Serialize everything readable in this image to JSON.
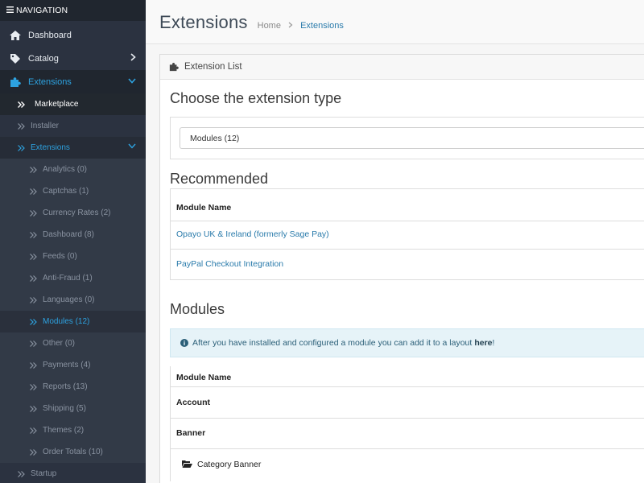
{
  "sidebar": {
    "header": "NAVIGATION",
    "dashboard": "Dashboard",
    "catalog": "Catalog",
    "extensions": "Extensions",
    "marketplace": "Marketplace",
    "installer": "Installer",
    "extensions_sub": "Extensions",
    "sub_items": [
      "Analytics (0)",
      "Captchas (1)",
      "Currency Rates (2)",
      "Dashboard (8)",
      "Feeds (0)",
      "Anti-Fraud (1)",
      "Languages (0)",
      "Modules (12)",
      "Other (0)",
      "Payments (4)",
      "Reports (13)",
      "Shipping (5)",
      "Themes (2)",
      "Order Totals (10)"
    ],
    "startup": "Startup"
  },
  "header": {
    "title": "Extensions",
    "breadcrumb_home": "Home",
    "breadcrumb_current": "Extensions"
  },
  "panel": {
    "heading": "Extension List",
    "choose_title": "Choose the extension type",
    "select_value": "Modules (12)",
    "recommended_title": "Recommended",
    "recommended_header": "Module Name",
    "recommended_items": [
      "Opayo UK & Ireland (formerly Sage Pay)",
      "PayPal Checkout Integration"
    ],
    "modules_title": "Modules",
    "alert_text": "After you have installed and configured a module you can add it to a layout ",
    "alert_link": "here",
    "alert_end": "!",
    "modules_header": "Module Name",
    "modules_rows": [
      "Account",
      "Banner",
      "Category Banner"
    ]
  },
  "colors": {
    "sidebar_bg": "#2b3240",
    "accent": "#2da2e0",
    "link": "#2a7bab"
  }
}
